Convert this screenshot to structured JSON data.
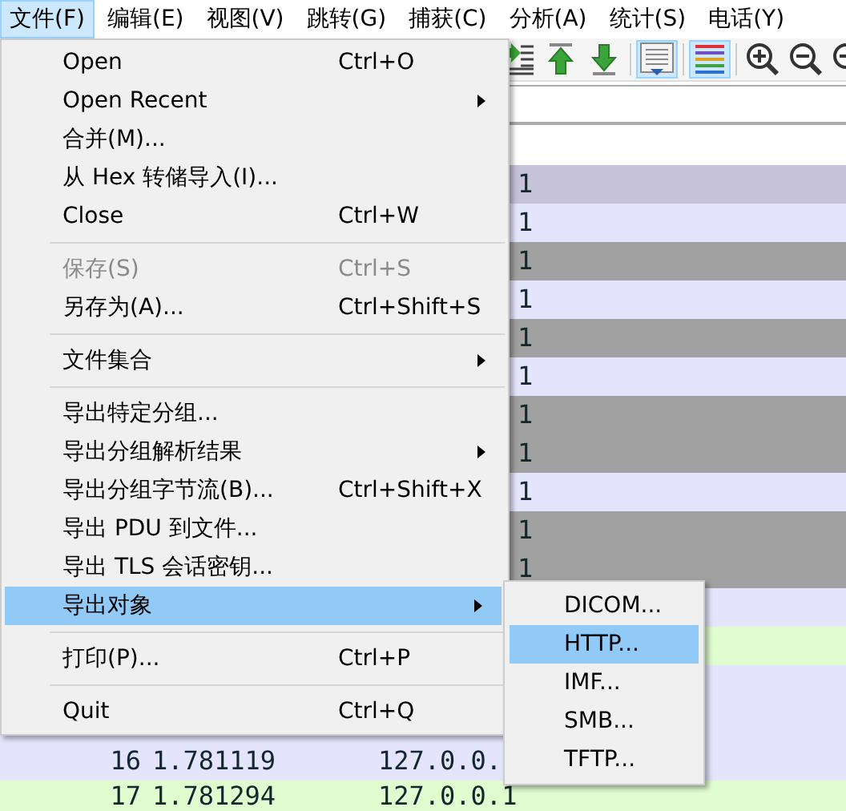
{
  "menubar": [
    {
      "label": "文件(F)",
      "selected": true
    },
    {
      "label": "编辑(E)",
      "selected": false
    },
    {
      "label": "视图(V)",
      "selected": false
    },
    {
      "label": "跳转(G)",
      "selected": false
    },
    {
      "label": "捕获(C)",
      "selected": false
    },
    {
      "label": "分析(A)",
      "selected": false
    },
    {
      "label": "统计(S)",
      "selected": false
    },
    {
      "label": "电话(Y)",
      "selected": false
    }
  ],
  "toolbar": [
    {
      "kind": "go-packet",
      "pressed": false
    },
    {
      "kind": "first-packet",
      "pressed": false
    },
    {
      "kind": "last-packet",
      "pressed": false
    },
    {
      "kind": "sep"
    },
    {
      "kind": "autoscroll",
      "pressed": true
    },
    {
      "kind": "sep"
    },
    {
      "kind": "colorize",
      "pressed": true
    },
    {
      "kind": "sep"
    },
    {
      "kind": "zoom-in",
      "pressed": false
    },
    {
      "kind": "zoom-out",
      "pressed": false
    },
    {
      "kind": "zoom-reset",
      "pressed": false
    }
  ],
  "packets": [
    {
      "color": "#c6c3d9",
      "tail": "1"
    },
    {
      "color": "#e4e4fc",
      "tail": "1"
    },
    {
      "color": "#a0a0a0",
      "tail": "1"
    },
    {
      "color": "#e4e4fc",
      "tail": "1"
    },
    {
      "color": "#a0a0a0",
      "tail": "1"
    },
    {
      "color": "#e4e4fc",
      "tail": "1"
    },
    {
      "color": "#a0a0a0",
      "tail": "1"
    },
    {
      "color": "#a0a0a0",
      "tail": "1"
    },
    {
      "color": "#e4e4fc",
      "tail": "1"
    },
    {
      "color": "#a0a0a0",
      "tail": "1"
    },
    {
      "color": "#a0a0a0",
      "tail": "1"
    },
    {
      "color": "#e4e4fc"
    },
    {
      "color": "#e0fdd0"
    },
    {
      "color": "#e4e4fc"
    },
    {
      "color": "#e4e4fc"
    },
    {
      "color": "#e4e4fc",
      "number": "16",
      "time": "1.781119",
      "source": "127.0.0."
    },
    {
      "color": "#e0fdd0",
      "number": "17",
      "time": "1.781294",
      "source": "127.0.0.1"
    }
  ],
  "file_menu": [
    {
      "kind": "item",
      "label": "Open",
      "shortcut": "Ctrl+O",
      "disabled": false,
      "selected": false
    },
    {
      "kind": "submenu",
      "label": "Open Recent",
      "disabled": false,
      "selected": false
    },
    {
      "kind": "item",
      "label": "合并(M)...",
      "disabled": false,
      "selected": false
    },
    {
      "kind": "item",
      "label": "从 Hex 转储导入(I)...",
      "disabled": false,
      "selected": false
    },
    {
      "kind": "item",
      "label": "Close",
      "shortcut": "Ctrl+W",
      "disabled": false,
      "selected": false
    },
    {
      "kind": "separator"
    },
    {
      "kind": "item",
      "label": "保存(S)",
      "shortcut": "Ctrl+S",
      "disabled": true,
      "selected": false
    },
    {
      "kind": "item",
      "label": "另存为(A)...",
      "shortcut": "Ctrl+Shift+S",
      "disabled": false,
      "selected": false
    },
    {
      "kind": "separator"
    },
    {
      "kind": "submenu",
      "label": "文件集合",
      "disabled": false,
      "selected": false
    },
    {
      "kind": "separator"
    },
    {
      "kind": "item",
      "label": "导出特定分组...",
      "disabled": false,
      "selected": false
    },
    {
      "kind": "submenu",
      "label": "导出分组解析结果",
      "disabled": false,
      "selected": false
    },
    {
      "kind": "item",
      "label": "导出分组字节流(B)...",
      "shortcut": "Ctrl+Shift+X",
      "disabled": false,
      "selected": false
    },
    {
      "kind": "item",
      "label": "导出 PDU 到文件...",
      "disabled": false,
      "selected": false
    },
    {
      "kind": "item",
      "label": "导出 TLS 会话密钥...",
      "disabled": false,
      "selected": false
    },
    {
      "kind": "submenu",
      "label": "导出对象",
      "disabled": false,
      "selected": true
    },
    {
      "kind": "separator"
    },
    {
      "kind": "item",
      "label": "打印(P)...",
      "shortcut": "Ctrl+P",
      "disabled": false,
      "selected": false
    },
    {
      "kind": "separator"
    },
    {
      "kind": "item",
      "label": "Quit",
      "shortcut": "Ctrl+Q",
      "disabled": false,
      "selected": false
    }
  ],
  "export_objects_menu": [
    {
      "label": "DICOM...",
      "selected": false
    },
    {
      "label": "HTTP...",
      "selected": true
    },
    {
      "label": "IMF...",
      "selected": false
    },
    {
      "label": "SMB...",
      "selected": false
    },
    {
      "label": "TFTP...",
      "selected": false
    }
  ]
}
